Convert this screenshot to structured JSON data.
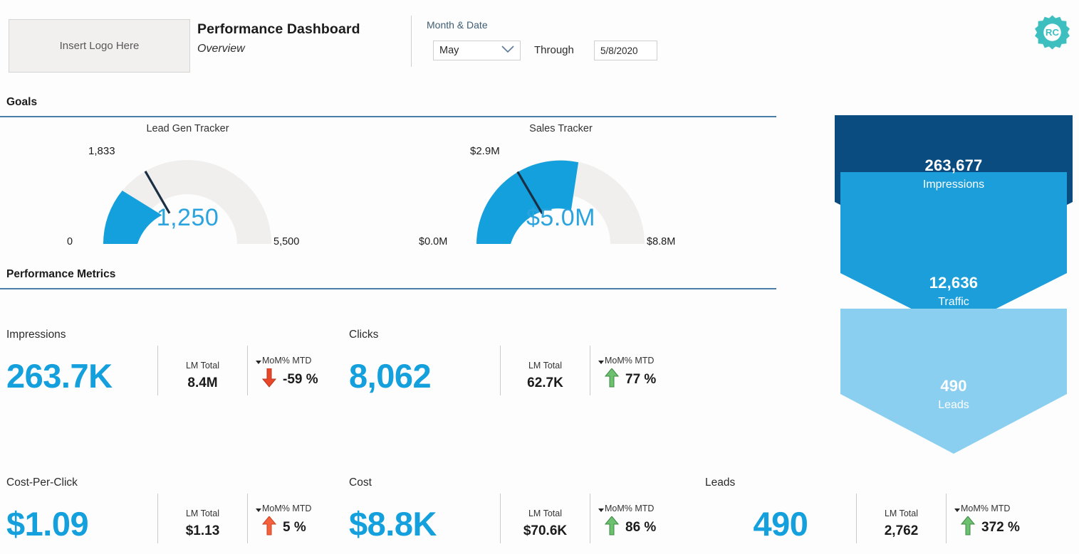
{
  "header": {
    "logo_placeholder": "Insert Logo Here",
    "title": "Performance Dashboard",
    "subtitle": "Overview",
    "filter_label": "Month & Date",
    "month_value": "May",
    "through_label": "Through",
    "date_value": "5/8/2020",
    "brand_mark": "RC",
    "chevron_icon": "chevron-down-icon"
  },
  "sections": {
    "goals": "Goals",
    "performance": "Performance Metrics"
  },
  "chart_data": [
    {
      "type": "gauge",
      "title": "Lead Gen Tracker",
      "value": 1250,
      "value_label": "1,250",
      "target": 1833,
      "target_label": "1,833",
      "min": 0,
      "min_label": "0",
      "max": 5500,
      "max_label": "5,500",
      "fill_color": "#14A0DC",
      "track_color": "#F0EFEE"
    },
    {
      "type": "gauge",
      "title": "Sales Tracker",
      "value": 5000000,
      "value_label": "$5.0M",
      "target": 2900000,
      "target_label": "$2.9M",
      "min": 0,
      "min_label": "$0.0M",
      "max": 8800000,
      "max_label": "$8.8M",
      "fill_color": "#14A0DC",
      "track_color": "#F0EFEE"
    },
    {
      "type": "funnel",
      "stages": [
        {
          "value": 263677,
          "value_label": "263,677",
          "label": "Impressions",
          "color": "#0A4C80"
        },
        {
          "value": 12636,
          "value_label": "12,636",
          "label": "Traffic",
          "color": "#1B9ED9"
        },
        {
          "value": 490,
          "value_label": "490",
          "label": "Leads",
          "color": "#8ACFF0"
        }
      ]
    }
  ],
  "metrics": [
    {
      "label": "Impressions",
      "value": "263.7K",
      "lm_title": "LM Total",
      "lm_value": "8.4M",
      "mom_title": "MoM% MTD",
      "mom_value": "-59 %",
      "mom_direction": "down",
      "mom_color": "#E8472A",
      "arrow_icon": "arrow-down-icon"
    },
    {
      "label": "Clicks",
      "value": "8,062",
      "lm_title": "LM Total",
      "lm_value": "62.7K",
      "mom_title": "MoM% MTD",
      "mom_value": "77 %",
      "mom_direction": "up",
      "mom_color": "#4CAF50",
      "arrow_icon": "arrow-up-icon"
    },
    {
      "label": "Cost-Per-Click",
      "value": "$1.09",
      "lm_title": "LM Total",
      "lm_value": "$1.13",
      "mom_title": "MoM% MTD",
      "mom_value": "5 %",
      "mom_direction": "up",
      "mom_color": "#F4613C",
      "arrow_icon": "arrow-up-icon"
    },
    {
      "label": "Cost",
      "value": "$8.8K",
      "lm_title": "LM Total",
      "lm_value": "$70.6K",
      "mom_title": "MoM% MTD",
      "mom_value": "86 %",
      "mom_direction": "up",
      "mom_color": "#4CAF50",
      "arrow_icon": "arrow-up-icon"
    },
    {
      "label": "Leads",
      "value": "490",
      "lm_title": "LM Total",
      "lm_value": "2,762",
      "mom_title": "MoM% MTD",
      "mom_value": "372 %",
      "mom_direction": "up",
      "mom_color": "#4CAF50",
      "arrow_icon": "arrow-up-icon"
    }
  ],
  "colors": {
    "accent_blue": "#14A0DC",
    "rule_blue": "#4A7EA8",
    "navy": "#0A4C80",
    "brand_teal": "#3EBFBF"
  }
}
